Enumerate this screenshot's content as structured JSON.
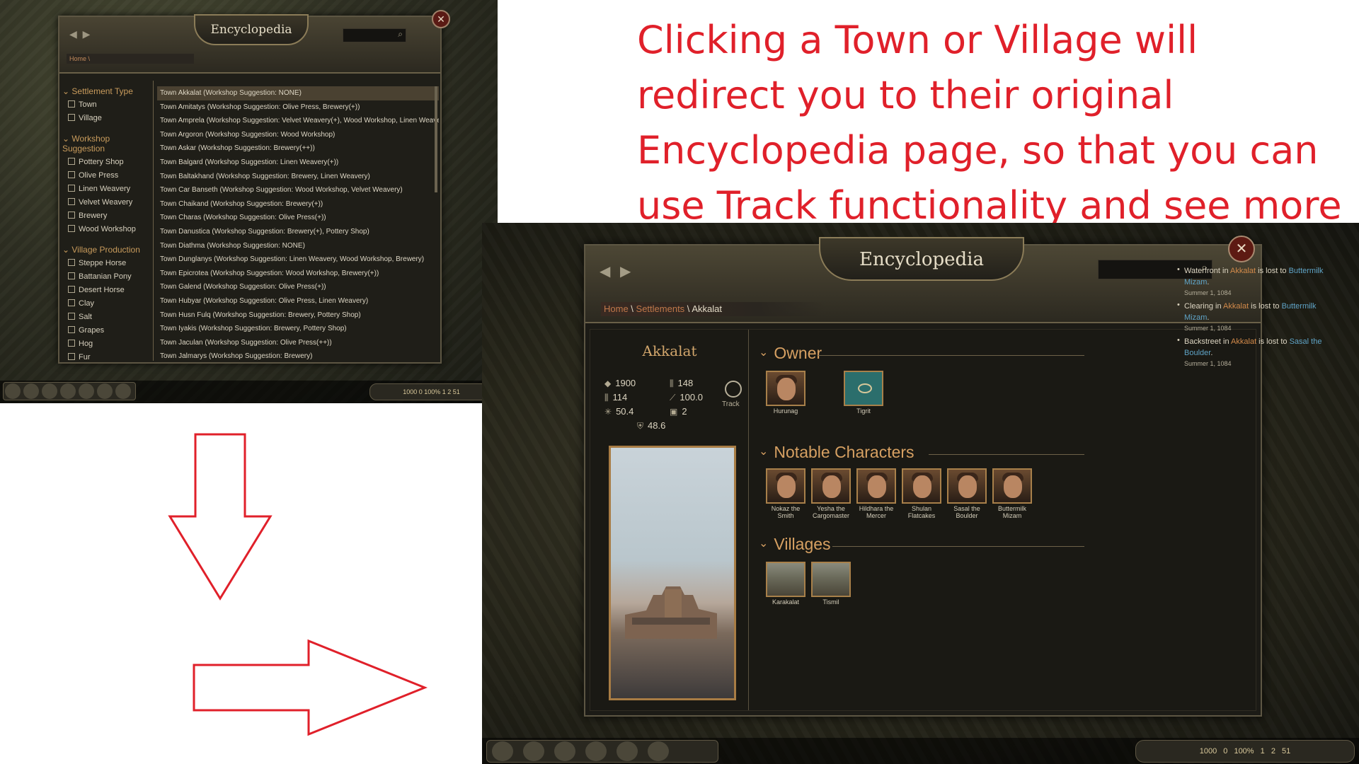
{
  "headline": "Clicking a Town or Village will redirect you to their original Encyclopedia page, so that you can use Track functionality and see more details.",
  "colors": {
    "annotation_red": "#e0202a",
    "accent_gold": "#d6a062",
    "link_blue": "#5fa3c6",
    "link_orange": "#c0784a"
  },
  "list_view": {
    "title": "Encyclopedia",
    "breadcrumb": "Home \\",
    "close_icon": "✕",
    "search_icon": "⌕",
    "nav_icons": "◀ ▶",
    "filters": [
      {
        "group": "Settlement Type",
        "options": [
          "Town",
          "Village"
        ]
      },
      {
        "group": "Workshop Suggestion",
        "options": [
          "Pottery Shop",
          "Olive Press",
          "Linen Weavery",
          "Velvet Weavery",
          "Brewery",
          "Wood Workshop"
        ]
      },
      {
        "group": "Village Production",
        "options": [
          "Steppe Horse",
          "Battanian Pony",
          "Desert Horse",
          "Clay",
          "Salt",
          "Grapes",
          "Hog",
          "Fur"
        ]
      }
    ],
    "rows": [
      "Town Akkalat (Workshop Suggestion: NONE)",
      "Town Amitatys (Workshop Suggestion: Olive Press, Brewery(+))",
      "Town Amprela (Workshop Suggestion: Velvet Weavery(+), Wood Workshop, Linen Weavery)",
      "Town Argoron (Workshop Suggestion: Wood Workshop)",
      "Town Askar (Workshop Suggestion: Brewery(++))",
      "Town Balgard (Workshop Suggestion: Linen Weavery(+))",
      "Town Baltakhand (Workshop Suggestion: Brewery, Linen Weavery)",
      "Town Car Banseth (Workshop Suggestion: Wood Workshop, Velvet Weavery)",
      "Town Chaikand (Workshop Suggestion: Brewery(+))",
      "Town Charas (Workshop Suggestion: Olive Press(+))",
      "Town Danustica (Workshop Suggestion: Brewery(+), Pottery Shop)",
      "Town Diathma (Workshop Suggestion: NONE)",
      "Town Dunglanys (Workshop Suggestion: Linen Weavery, Wood Workshop, Brewery)",
      "Town Epicrotea (Workshop Suggestion: Wood Workshop, Brewery(+))",
      "Town Galend (Workshop Suggestion: Olive Press(+))",
      "Town Hubyar (Workshop Suggestion: Olive Press, Linen Weavery)",
      "Town Husn Fulq (Workshop Suggestion: Brewery, Pottery Shop)",
      "Town Iyakis (Workshop Suggestion: Brewery, Pottery Shop)",
      "Town Jaculan (Workshop Suggestion: Olive Press(++))",
      "Town Jalmarys (Workshop Suggestion: Brewery)"
    ],
    "hud_stats": "1000 0 100% 1 2 51"
  },
  "detail_view": {
    "title": "Encyclopedia",
    "close_icon": "✕",
    "search_icon": "⌕",
    "nav_icons": "◀ ▶",
    "breadcrumb": {
      "home": "Home",
      "settlements": "Settlements",
      "current": "Akkalat",
      "sep": " \\ "
    },
    "settlement_name": "Akkalat",
    "stats": {
      "prosperity": "1900",
      "militia": "114",
      "loyalty": "50.4",
      "garrison": "148",
      "security": "100.0",
      "food": "2",
      "wall": "48.6"
    },
    "track_label": "Track",
    "sections": {
      "owner": "Owner",
      "notables": "Notable Characters",
      "villages": "Villages"
    },
    "owner": [
      {
        "name": "Hurunag"
      },
      {
        "name": "Tigrit"
      }
    ],
    "notables": [
      {
        "name": "Nokaz the Smith"
      },
      {
        "name": "Yesha the Cargomaster"
      },
      {
        "name": "Hildhara the Mercer"
      },
      {
        "name": "Shulan Flatcakes"
      },
      {
        "name": "Sasal the Boulder"
      },
      {
        "name": "Buttermilk Mizam"
      }
    ],
    "villages": [
      {
        "name": "Karakalat"
      },
      {
        "name": "Tismil"
      }
    ],
    "log": [
      {
        "pre": "Waterfront in ",
        "town": "Akkalat",
        "mid": " is lost to ",
        "who": "Buttermilk Mizam",
        "post": ".",
        "date": "Summer 1, 1084"
      },
      {
        "pre": "Clearing in ",
        "town": "Akkalat",
        "mid": " is lost to ",
        "who": "Buttermilk Mizam",
        "post": ".",
        "date": "Summer 1, 1084"
      },
      {
        "pre": "Backstreet in ",
        "town": "Akkalat",
        "mid": " is lost to ",
        "who": "Sasal the Boulder",
        "post": ".",
        "date": "Summer 1, 1084"
      }
    ],
    "hud_stats": "1000 0 100% 1 2 51"
  }
}
